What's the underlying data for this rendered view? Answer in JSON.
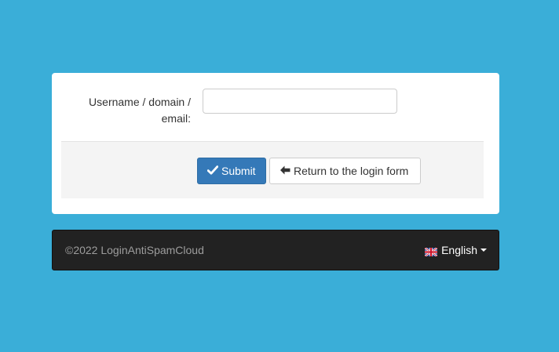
{
  "form": {
    "label": "Username / domain / email:",
    "input_value": "",
    "input_placeholder": ""
  },
  "actions": {
    "submit_label": "Submit",
    "submit_icon": "checkmark-icon",
    "return_label": "Return to the login form",
    "return_icon": "arrow-left-icon"
  },
  "footer": {
    "copyright": "©2022 LoginAntiSpamCloud",
    "language": "English",
    "language_icon": "uk-flag-icon"
  },
  "colors": {
    "background": "#3aaed8",
    "primary": "#3579b8",
    "footer": "#222222"
  }
}
